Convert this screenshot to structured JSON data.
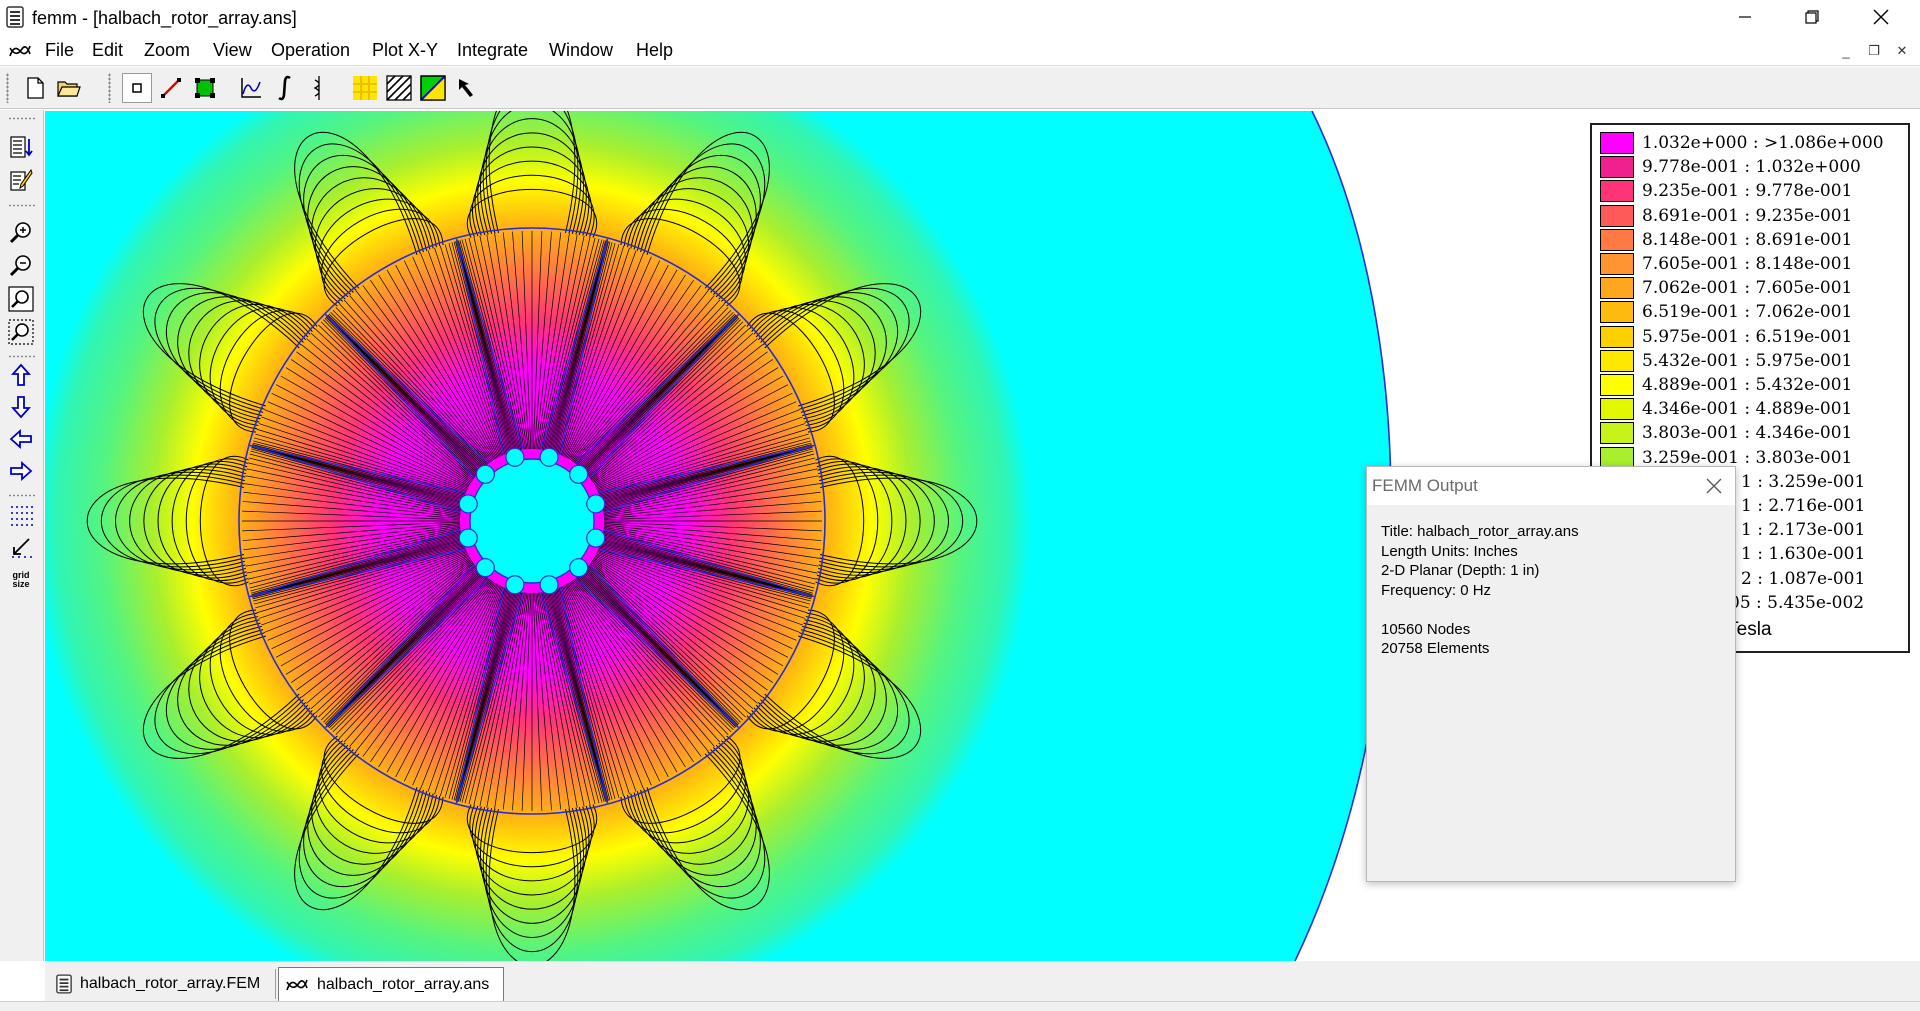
{
  "window": {
    "title": "femm - [halbach_rotor_array.ans]",
    "minimize": "–",
    "restore": "❐",
    "close": "✕"
  },
  "menu": {
    "items": [
      "File",
      "Edit",
      "Zoom",
      "View",
      "Operation",
      "Plot X-Y",
      "Integrate",
      "Window",
      "Help"
    ],
    "mdi_minimize": "_",
    "mdi_restore": "❐",
    "mdi_close": "✕"
  },
  "toolbar": {
    "icons": [
      "new-document-icon",
      "open-folder-icon",
      "node-mode-icon",
      "segment-mode-icon",
      "block-mode-icon",
      "plot-xy-icon",
      "integrate-icon",
      "contour-icon",
      "density-plot-icon",
      "vector-plot-icon",
      "flux-lines-icon",
      "pointer-icon"
    ]
  },
  "left_toolbar": {
    "icons": [
      "show-results-icon",
      "edit-notes-icon",
      "zoom-in-icon",
      "zoom-out-icon",
      "zoom-natural-icon",
      "zoom-window-icon",
      "pan-up-icon",
      "pan-down-icon",
      "pan-left-icon",
      "pan-right-icon",
      "show-grid-icon",
      "snap-grid-icon",
      "grid-size-icon"
    ],
    "grid_size_label_1": "grid",
    "grid_size_label_2": "size"
  },
  "legend": {
    "entries": [
      {
        "label": "1.032e+000 : >1.086e+000",
        "color": "#ff00ff"
      },
      {
        "label": "9.778e-001 : 1.032e+000",
        "color": "#f0218f"
      },
      {
        "label": "9.235e-001 : 9.778e-001",
        "color": "#ff3478"
      },
      {
        "label": "8.691e-001 : 9.235e-001",
        "color": "#ff5a5a"
      },
      {
        "label": "8.148e-001 : 8.691e-001",
        "color": "#ff7a42"
      },
      {
        "label": "7.605e-001 : 8.148e-001",
        "color": "#ff9430"
      },
      {
        "label": "7.062e-001 : 7.605e-001",
        "color": "#ffa61f"
      },
      {
        "label": "6.519e-001 : 7.062e-001",
        "color": "#ffba10"
      },
      {
        "label": "5.975e-001 : 6.519e-001",
        "color": "#ffd000"
      },
      {
        "label": "5.432e-001 : 5.975e-001",
        "color": "#ffe800"
      },
      {
        "label": "4.889e-001 : 5.432e-001",
        "color": "#ffff00"
      },
      {
        "label": "4.346e-001 : 4.889e-001",
        "color": "#e2f800"
      },
      {
        "label": "3.803e-001 : 4.346e-001",
        "color": "#c8f31a"
      },
      {
        "label": "3.259e-001 : 3.803e-001",
        "color": "#a8ef2e"
      },
      {
        "label": "1 : 3.259e-001",
        "color": ""
      },
      {
        "label": "1 : 2.716e-001",
        "color": ""
      },
      {
        "label": "1 : 2.173e-001",
        "color": ""
      },
      {
        "label": "1 : 1.630e-001",
        "color": ""
      },
      {
        "label": "2 : 1.087e-001",
        "color": ""
      },
      {
        "label": "05 : 5.435e-002",
        "color": ""
      }
    ],
    "caption": "|, Tesla"
  },
  "output_window": {
    "title": "FEMM Output",
    "lines": [
      "Title: halbach_rotor_array.ans",
      "Length Units: Inches",
      "2-D Planar (Depth: 1 in)",
      "Frequency: 0 Hz",
      "",
      "10560 Nodes",
      "20758 Elements"
    ]
  },
  "tabs": [
    {
      "label": "halbach_rotor_array.FEM",
      "icon": "femm-preprocessor-icon"
    },
    {
      "label": "halbach_rotor_array.ans",
      "icon": "femm-postprocessor-icon"
    }
  ],
  "colors": {
    "background_field": "#00ffff",
    "boundary_line": "#2a2ad0",
    "flux_line": "#000000"
  }
}
